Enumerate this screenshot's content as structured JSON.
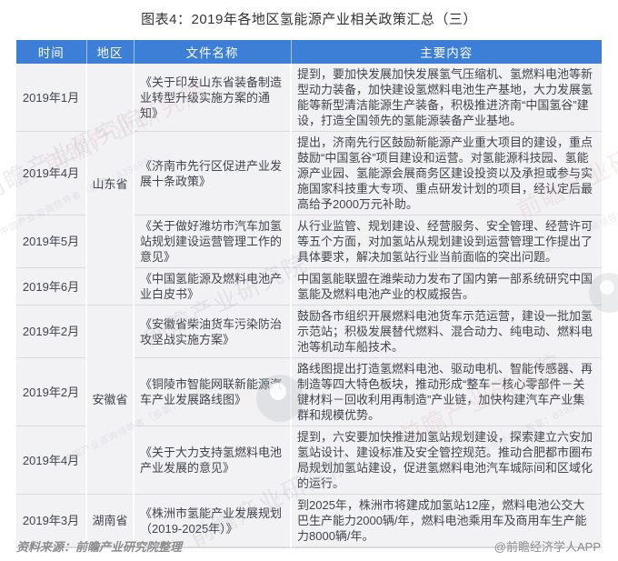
{
  "title": "图表4：2019年各地区氢能源产业相关政策汇总（三）",
  "colors": {
    "header_bg": "#3d7ed6",
    "header_text": "#ffffff",
    "cell_bg": "#f2f2f5",
    "body_text": "#40444c",
    "title_text": "#333333",
    "footer_text": "#8c8c8c"
  },
  "table": {
    "headers": [
      "时间",
      "地区",
      "文件名称",
      "主要内容"
    ],
    "groups": [
      {
        "region": "山东省",
        "rows": [
          {
            "date": "2019年1月",
            "doc": "《关于印发山东省装备制造业转型升级实施方案的通知》",
            "content": "提到，要加快发展加快发展氢气压缩机、氢燃料电池等新型动力装备，加快建设氢燃料电池生产基地，大力发展氢能等新型清洁能源生产装备，积极推进济南“中国氢谷”建设，打造全国领先的氢能源装备产业基地。"
          },
          {
            "date": "2019年4月",
            "doc": "《济南市先行区促进产业发展十条政策》",
            "content": "提出，济南先行区鼓励新能源产业重大项目的建设，重点鼓励“中国氢谷”项目建设和运营。对氢能源科技园、氢能源产业园、氢能源会展商务区建设投资以及承担或参与实施国家科技重大专项、重点研发计划的项目，经认定后最高给予2000万元补助。"
          },
          {
            "date": "2019年5月",
            "doc": "《关于做好潍坊市汽车加氢站规划建设运营管理工作的意见》",
            "content": "从行业监管、规划建设、经营服务、安全管理、经营许可等五个方面，对加氢站从规划建设到运营管理工作提出了具体要求，解决加氢站行业当前面临的突出问题。"
          },
          {
            "date": "2019年6月",
            "doc": "《中国氢能源及燃料电池产业白皮书》",
            "content": "中国氢能联盟在潍柴动力发布了国内第一部系统研究中国氢能及燃料电池产业的权威报告。"
          }
        ]
      },
      {
        "region": "安徽省",
        "rows": [
          {
            "date": "2019年2月",
            "doc": "《安徽省柴油货车污染防治攻坚战实施方案》",
            "content": "鼓励各市组织开展燃料电池货车示范运营，建设一批加氢示范站；积极发展替代燃料、混合动力、纯电动、燃料电池等机动车船技术。"
          },
          {
            "date": "2019年2月",
            "doc": "《铜陵市智能网联新能源汽车产业发展路线图》",
            "content": "路线图提出打造氢燃料电池、驱动电机、智能传感器、再制造等四大特色板块，推动形成“整车－核心零部件－关键材料－回收利用再制造”产业链，加快构建汽车产业集群和规模优势。"
          },
          {
            "date": "2019年4月",
            "doc": "《关于大力支持氢燃料电池产业发展的意见》",
            "content": "提到，六安要加快推进加氢站规划建设，探索建立六安加氢站设计、建设标准及安全管控规范。推动合肥都市圈布局规划加氢站建设，促进氢燃料电池汽车城际间和区域化的运行。"
          }
        ]
      },
      {
        "region": "湖南省",
        "rows": [
          {
            "date": "2019年3月",
            "doc": "《株洲市氢能产业发展规划（2019-2025年）》",
            "content": "到2025年，株洲市将建成加氢站12座，燃料电池公交大巴生产能力2000辆/年，燃料电池乘用车及商用车生产能力8000辆/年。"
          }
        ]
      }
    ]
  },
  "watermark": {
    "text": "前瞻产业研究院",
    "subtext": "中国产业咨询领导者（股票：839599）"
  },
  "footer": {
    "source": "资料来源：前瞻产业研究院整理",
    "credit": "@前瞻经济学人APP"
  }
}
